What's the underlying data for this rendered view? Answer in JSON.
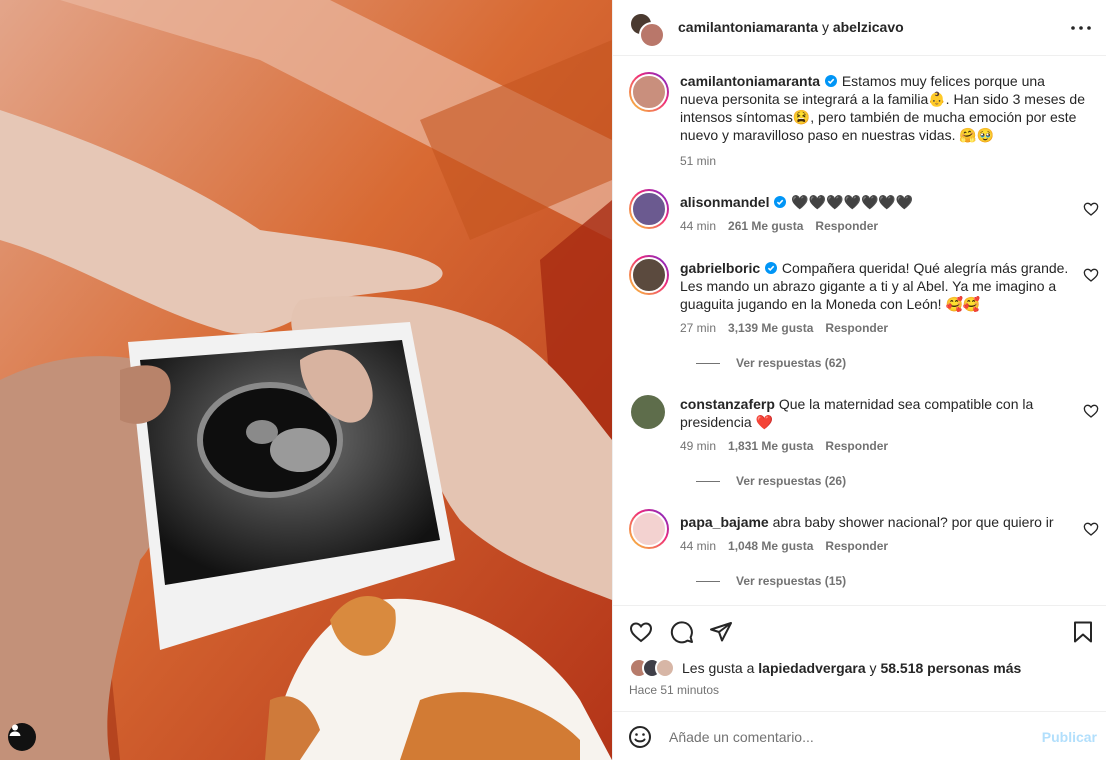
{
  "header": {
    "user1": "camilantoniamaranta",
    "conj": " y ",
    "user2": "abelzicavo",
    "more_icon": "more-horizontal-icon"
  },
  "caption": {
    "user": "camilantoniamaranta",
    "text": "Estamos muy felices porque una nueva personita se integrará a la familia👶. Han sido 3 meses de intensos síntomas😫, pero también de mucha emoción por este nuevo y maravilloso paso en nuestras vidas. 🤗🥹",
    "time": "51 min"
  },
  "comments": [
    {
      "user": "alisonmandel",
      "verified": true,
      "text": "🖤🖤🖤🖤🖤🖤🖤",
      "time": "44 min",
      "likes": "261 Me gusta",
      "reply": "Responder",
      "replies": ""
    },
    {
      "user": "gabrielboric",
      "verified": true,
      "text": "Compañera querida! Qué alegría más grande. Les mando un abrazo gigante a ti y al Abel. Ya me imagino a guaguita jugando en la Moneda con León! 🥰🥰",
      "time": "27 min",
      "likes": "3,139 Me gusta",
      "reply": "Responder",
      "replies": "Ver respuestas (62)"
    },
    {
      "user": "constanzaferp",
      "verified": false,
      "text": "Que la maternidad sea compatible con la presidencia ❤️",
      "time": "49 min",
      "likes": "1,831 Me gusta",
      "reply": "Responder",
      "replies": "Ver respuestas (26)"
    },
    {
      "user": "papa_bajame",
      "verified": false,
      "text": "abra baby shower nacional? por que quiero ir",
      "time": "44 min",
      "likes": "1,048 Me gusta",
      "reply": "Responder",
      "replies": "Ver respuestas (15)"
    }
  ],
  "likes": {
    "prefix": "Les gusta a ",
    "user": "lapiedadvergara",
    "mid": " y ",
    "others": "58.518 personas más"
  },
  "posted_ago": "Hace 51 minutos",
  "composer": {
    "placeholder": "Añade un comentario...",
    "post_label": "Publicar"
  },
  "colors": {
    "accent": "#0095f6",
    "post_disabled": "#b2dffc",
    "secondary_text": "#737373"
  }
}
